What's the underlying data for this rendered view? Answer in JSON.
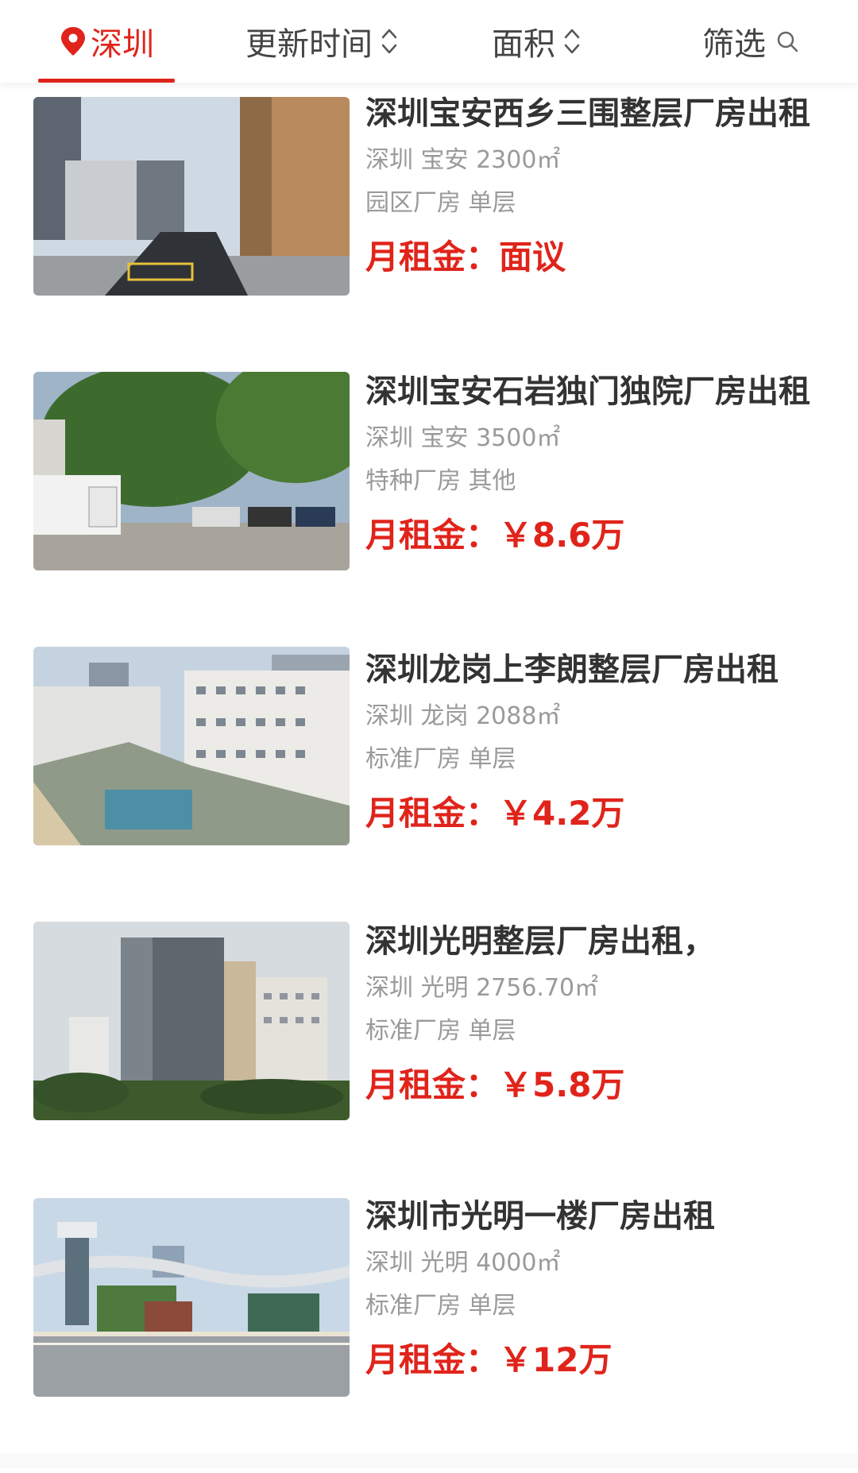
{
  "topbar": {
    "city_label": "深圳",
    "update_label": "更新时间",
    "area_label": "面积",
    "filter_label": "筛选",
    "accent_color": "#e0241b"
  },
  "listings": [
    {
      "title": "深圳宝安西乡三围整层厂房出租",
      "location": "深圳 宝安 2300㎡",
      "type": "园区厂房 单层",
      "price_label": "月租金：",
      "price_value": "面议"
    },
    {
      "title": "深圳宝安石岩独门独院厂房出租",
      "location": "深圳 宝安 3500㎡",
      "type": "特种厂房 其他",
      "price_label": "月租金：",
      "price_value": "￥8.6万"
    },
    {
      "title": "深圳龙岗上李朗整层厂房出租",
      "location": "深圳 龙岗 2088㎡",
      "type": "标准厂房 单层",
      "price_label": "月租金：",
      "price_value": "￥4.2万"
    },
    {
      "title": "深圳光明整层厂房出租，",
      "location": "深圳 光明 2756.70㎡",
      "type": "标准厂房 单层",
      "price_label": "月租金：",
      "price_value": "￥5.8万"
    },
    {
      "title": "深圳市光明一楼厂房出租",
      "location": "深圳 光明 4000㎡",
      "type": "标准厂房 单层",
      "price_label": "月租金：",
      "price_value": "￥12万"
    }
  ]
}
